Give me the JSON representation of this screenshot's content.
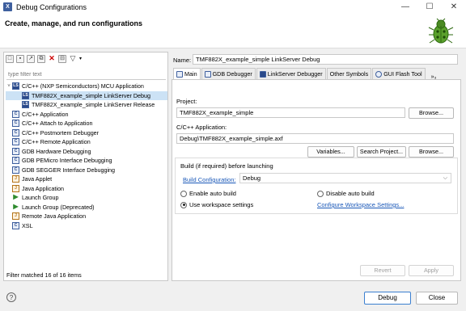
{
  "window": {
    "title": "Debug Configurations",
    "minimize": "—",
    "maximize": "☐",
    "close": "✕"
  },
  "header": {
    "title": "Create, manage, and run configurations"
  },
  "left": {
    "filter_placeholder": "type filter text",
    "tree": [
      {
        "label": "C/C++ (NXP Semiconductors) MCU Application",
        "level": 0,
        "icon": "ls",
        "twisty": "˅"
      },
      {
        "label": "TMF882X_example_simple LinkServer Debug",
        "level": 1,
        "icon": "ls",
        "selected": true
      },
      {
        "label": "TMF882X_example_simple LinkServer Release",
        "level": 1,
        "icon": "ls"
      },
      {
        "label": "C/C++ Application",
        "level": 0,
        "icon": "c"
      },
      {
        "label": "C/C++ Attach to Application",
        "level": 0,
        "icon": "c"
      },
      {
        "label": "C/C++ Postmortem Debugger",
        "level": 0,
        "icon": "c"
      },
      {
        "label": "C/C++ Remote Application",
        "level": 0,
        "icon": "c"
      },
      {
        "label": "GDB Hardware Debugging",
        "level": 0,
        "icon": "c"
      },
      {
        "label": "GDB PEMicro Interface Debugging",
        "level": 0,
        "icon": "c"
      },
      {
        "label": "GDB SEGGER Interface Debugging",
        "level": 0,
        "icon": "c"
      },
      {
        "label": "Java Applet",
        "level": 0,
        "icon": "java"
      },
      {
        "label": "Java Application",
        "level": 0,
        "icon": "java"
      },
      {
        "label": "Launch Group",
        "level": 0,
        "icon": "launch"
      },
      {
        "label": "Launch Group (Deprecated)",
        "level": 0,
        "icon": "launch"
      },
      {
        "label": "Remote Java Application",
        "level": 0,
        "icon": "java"
      },
      {
        "label": "XSL",
        "level": 0,
        "icon": "c"
      }
    ],
    "status": "Filter matched 16 of 16 items"
  },
  "right": {
    "name_label": "Name:",
    "name_value": "TMF882X_example_simple LinkServer Debug",
    "tabs": [
      "Main",
      "GDB Debugger",
      "LinkServer Debugger",
      "Other Symbols",
      "GUI Flash Tool"
    ],
    "tab_overflow": "»₃",
    "project_label": "Project:",
    "project_value": "TMF882X_example_simple",
    "browse1": "Browse...",
    "app_label": "C/C++ Application:",
    "app_value": "Debug\\TMF882X_example_simple.axf",
    "variables": "Variables...",
    "search_project": "Search Project...",
    "browse2": "Browse...",
    "build_group_title": "Build (if required) before launching",
    "build_config_link": "Build Configuration:",
    "build_config_value": "Debug",
    "enable_auto_build": "Enable auto build",
    "disable_auto_build": "Disable auto build",
    "use_workspace": "Use workspace settings",
    "configure_workspace": "Configure Workspace Settings...",
    "revert": "Revert",
    "apply": "Apply"
  },
  "bottom": {
    "help": "?",
    "debug": "Debug",
    "close": "Close"
  }
}
